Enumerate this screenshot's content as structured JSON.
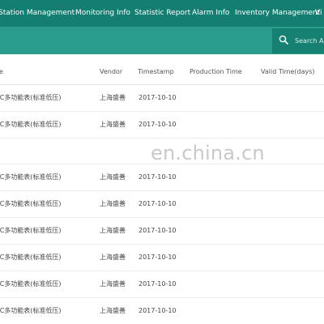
{
  "nav": {
    "items": [
      {
        "label": "Station Management"
      },
      {
        "label": "Monitoring Info"
      },
      {
        "label": "Statistic Report"
      },
      {
        "label": "Alarm Info"
      },
      {
        "label": "Inventory Management"
      },
      {
        "label": "Vi"
      }
    ]
  },
  "search": {
    "placeholder": "Search A"
  },
  "table": {
    "columns": [
      "e",
      "Vendor",
      "Timestamp",
      "Production Time",
      "Valid Time(days)"
    ],
    "rows": [
      {
        "name": "/C多功能表(标准低压)",
        "vendor": "上海盛善",
        "timestamp": "2017-10-10",
        "production": "",
        "valid": ""
      },
      {
        "name": "/C多功能表(标准低压)",
        "vendor": "上海盛善",
        "timestamp": "2017-10-10",
        "production": "",
        "valid": ""
      },
      {
        "name": "",
        "vendor": "",
        "timestamp": "",
        "production": "",
        "valid": ""
      },
      {
        "name": "/C多功能表(标准低压)",
        "vendor": "上海盛善",
        "timestamp": "2017-10-10",
        "production": "",
        "valid": ""
      },
      {
        "name": "/C多功能表(标准低压)",
        "vendor": "上海盛善",
        "timestamp": "2017-10-10",
        "production": "",
        "valid": ""
      },
      {
        "name": "/C多功能表(标准低压)",
        "vendor": "上海盛善",
        "timestamp": "2017-10-10",
        "production": "",
        "valid": ""
      },
      {
        "name": "/C多功能表(标准低压)",
        "vendor": "上海盛善",
        "timestamp": "2017-10-10",
        "production": "",
        "valid": ""
      },
      {
        "name": "/C多功能表(标准低压)",
        "vendor": "上海盛善",
        "timestamp": "2017-10-10",
        "production": "",
        "valid": ""
      },
      {
        "name": "/C多功能表(标准低压)",
        "vendor": "上海盛善",
        "timestamp": "2017-10-10",
        "production": "",
        "valid": ""
      }
    ]
  },
  "watermark": "en.china.cn",
  "colors": {
    "nav_bg": "#157e73",
    "subbar_bg": "#2a9d8f",
    "search_bg": "#168173"
  }
}
